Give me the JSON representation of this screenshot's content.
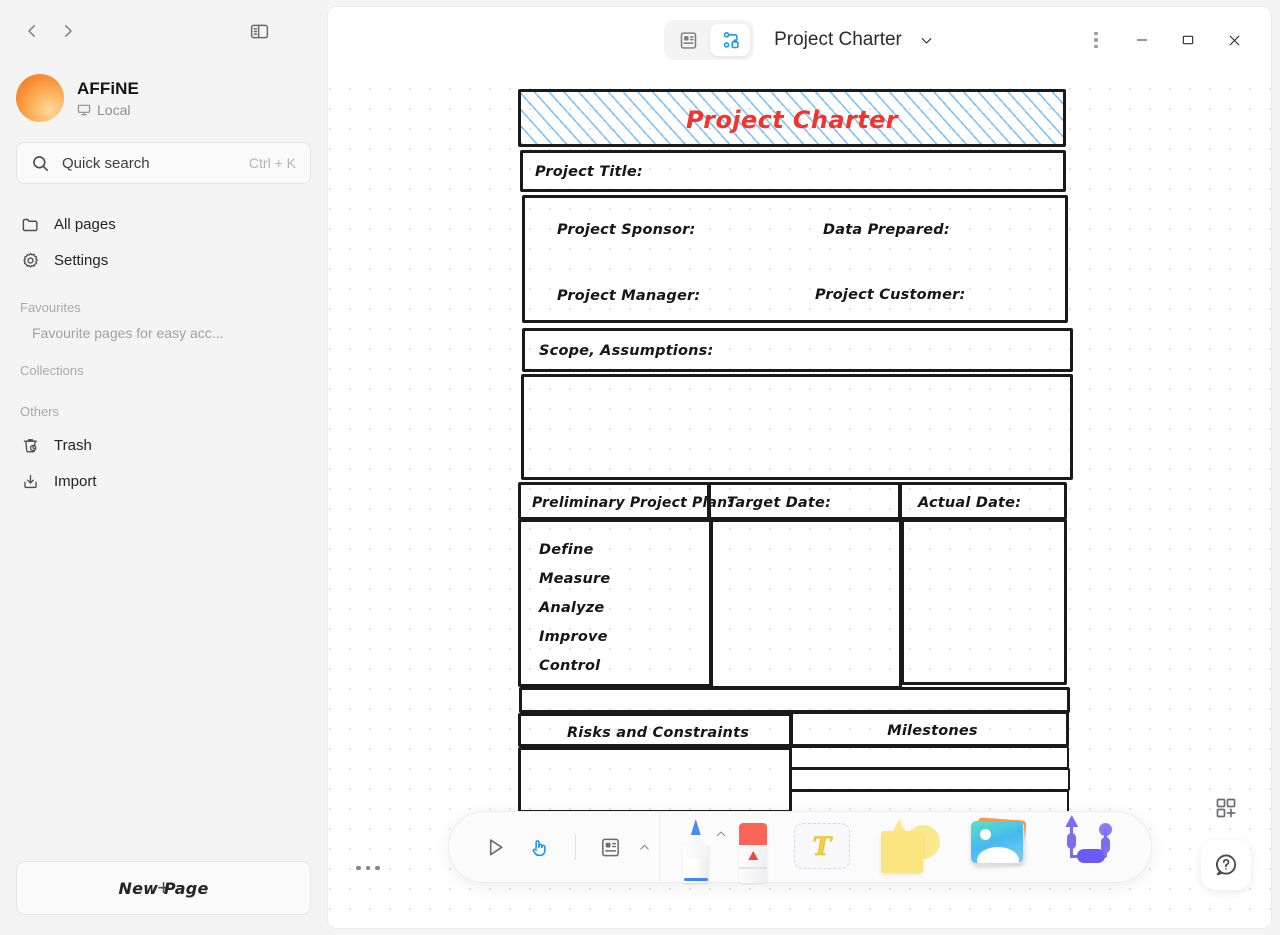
{
  "sidebar": {
    "nav": {
      "back_icon": "chevron-left-icon",
      "forward_icon": "chevron-right-icon",
      "toggle_icon": "sidebar-toggle-icon"
    },
    "workspace": {
      "name": "AFFiNE",
      "sync_label": "Local",
      "sync_icon": "desktop-icon"
    },
    "search": {
      "label": "Quick search",
      "shortcut": "Ctrl + K",
      "icon": "search-icon"
    },
    "primary_items": [
      {
        "label": "All pages",
        "icon": "folder-icon"
      },
      {
        "label": "Settings",
        "icon": "gear-icon"
      }
    ],
    "sections": [
      {
        "title": "Favourites",
        "empty_text": "Favourite pages for easy acc..."
      },
      {
        "title": "Collections"
      },
      {
        "title": "Others"
      }
    ],
    "other_items": [
      {
        "label": "Trash",
        "icon": "trash-icon"
      },
      {
        "label": "Import",
        "icon": "import-icon"
      }
    ],
    "new_page": {
      "label": "New Page",
      "plus": "+"
    }
  },
  "titlebar": {
    "modes": [
      {
        "name": "page-mode",
        "icon": "page-icon",
        "active": false
      },
      {
        "name": "edgeless-mode",
        "icon": "edgeless-icon",
        "active": true
      }
    ],
    "doc_title": "Project Charter",
    "chevron_icon": "chevron-down-icon",
    "window": {
      "more_icon": "more-vertical-icon",
      "minimize_icon": "minimize-icon",
      "maximize_icon": "maximize-icon",
      "close_icon": "close-icon"
    }
  },
  "canvas": {
    "charter": {
      "title": "Project Charter",
      "title_color": "#f2332e",
      "hatch_color": "#7dc0f0",
      "stroke_color": "#1a1a1a",
      "fields": {
        "project_title": "Project Title:",
        "project_sponsor": "Project Sponsor:",
        "data_prepared": "Data Prepared:",
        "project_manager": "Project Manager:",
        "project_customer": "Project Customer:",
        "scope_assumptions": "Scope, Assumptions:",
        "preliminary_plan": "Preliminary Project Plan:",
        "target_date": "Target Date:",
        "actual_date": "Actual Date:",
        "risks": "Risks and Constraints",
        "milestones": "Milestones"
      },
      "dmaic": [
        "Define",
        "Measure",
        "Analyze",
        "Improve",
        "Control"
      ]
    },
    "zoom_dots_icon": "zoom-bar-toggle-icon"
  },
  "toolbar": {
    "left": [
      {
        "name": "select-tool",
        "icon": "cursor-arrow-icon",
        "active": false
      },
      {
        "name": "hand-tool",
        "icon": "hand-icon",
        "active": true
      },
      {
        "name": "note-tool",
        "icon": "note-icon",
        "active": false
      }
    ],
    "note_chevron_icon": "chevron-up-icon",
    "pen": {
      "name": "pen-tool",
      "icon": "pen-icon",
      "chevron_icon": "chevron-up-icon",
      "color": "#4a8bf5"
    },
    "eraser": {
      "name": "eraser-tool",
      "icon": "eraser-icon",
      "color": "#fa6558"
    },
    "text": {
      "name": "text-tool",
      "icon": "text-icon",
      "glyph": "T",
      "color": "#f2cf3f"
    },
    "shape": {
      "name": "shape-tool",
      "icon": "shapes-icon",
      "color": "#fae57e"
    },
    "image": {
      "name": "image-tool",
      "icon": "image-icon"
    },
    "connector": {
      "name": "connector-tool",
      "icon": "connector-icon",
      "color": "#7c6ef0"
    }
  },
  "floats": {
    "template_icon": "add-template-icon",
    "help_icon": "help-question-icon"
  }
}
